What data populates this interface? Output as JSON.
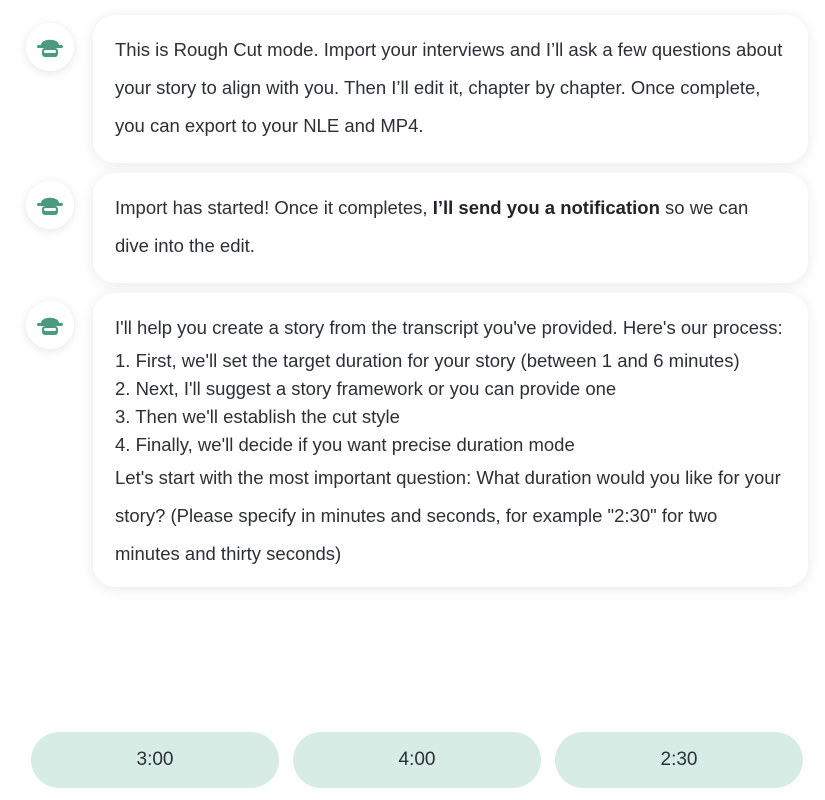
{
  "colors": {
    "accent": "#4a9b80",
    "choice_bg": "#d8ece6",
    "text": "#2b2f36"
  },
  "assistant_icon": "robot-face-icon",
  "messages": [
    {
      "text": "This is Rough Cut mode. Import your interviews and I’ll ask a few questions about your story to align with you. Then I’ll edit it, chapter by chapter. Once complete, you can export to your NLE and MP4."
    },
    {
      "text_before": "Import has started! Once it completes, ",
      "text_bold": "I’ll send you a notification",
      "text_after": " so we can dive into the edit."
    },
    {
      "intro": "I'll help you create a story from the transcript you've provided. Here's our process:",
      "steps": [
        "1. First, we'll set the target duration for your story (between 1 and 6 minutes)",
        "2. Next, I'll suggest a story framework or you can provide one",
        "3. Then we'll establish the cut style",
        "4. Finally, we'll decide if you want precise duration mode"
      ],
      "question": "Let's start with the most important question: What duration would you like for your story? (Please specify in minutes and seconds, for example \"2:30\" for two minutes and thirty seconds)"
    }
  ],
  "choices": [
    "3:00",
    "4:00",
    "2:30"
  ]
}
